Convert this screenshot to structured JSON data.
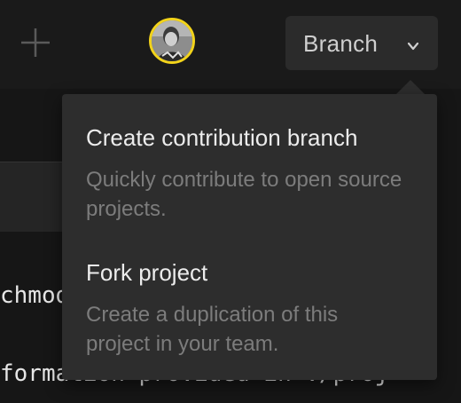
{
  "topbar": {
    "add_icon": "plus-icon",
    "avatar_icon": "user-avatar",
    "branch_button": {
      "label": "Branch",
      "icon": "chevron-down-icon"
    }
  },
  "editor": {
    "lines": [
      "chmod",
      "formation provided in ./proj"
    ]
  },
  "menu": {
    "items": [
      {
        "title": "Create contribution branch",
        "description": "Quickly contribute to open source projects."
      },
      {
        "title": "Fork project",
        "description": "Create a duplication of this project in your team."
      }
    ]
  },
  "colors": {
    "background": "#161616",
    "menu_bg": "#2d2d2d",
    "avatar_ring": "#f2d31b",
    "muted_text": "#7c7c7c"
  }
}
